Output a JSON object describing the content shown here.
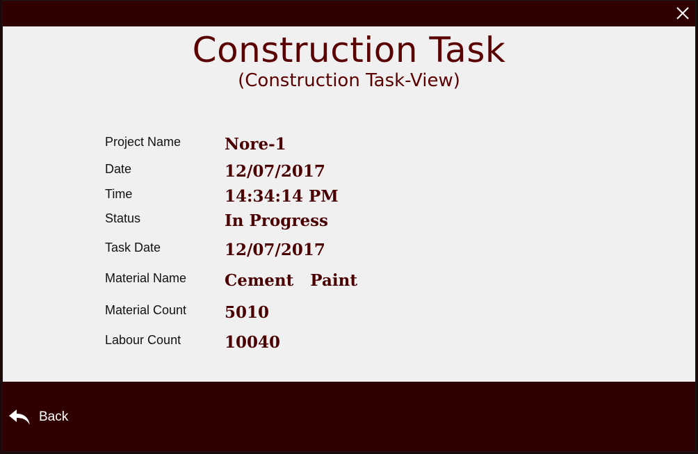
{
  "header": {
    "title": "Construction Task",
    "subtitle": "(Construction Task-View)"
  },
  "fields": [
    {
      "label": "Project Name",
      "value": "Nore-1"
    },
    {
      "label": "Date",
      "value": "12/07/2017"
    },
    {
      "label": "Time",
      "value": "14:34:14 PM"
    },
    {
      "label": "Status",
      "value": "In Progress"
    },
    {
      "label": "Task Date",
      "value": "12/07/2017"
    },
    {
      "label": "Material Name",
      "value": "Cement   Paint"
    },
    {
      "label": "Material Count",
      "value": "5010"
    },
    {
      "label": "Labour Count",
      "value": "10040"
    }
  ],
  "footer": {
    "back_label": "Back"
  },
  "icons": {
    "close": "close-icon",
    "back": "reply-arrow-icon"
  },
  "colors": {
    "bar": "#300000",
    "accent": "#5a0000",
    "background": "#f0f0f0"
  }
}
